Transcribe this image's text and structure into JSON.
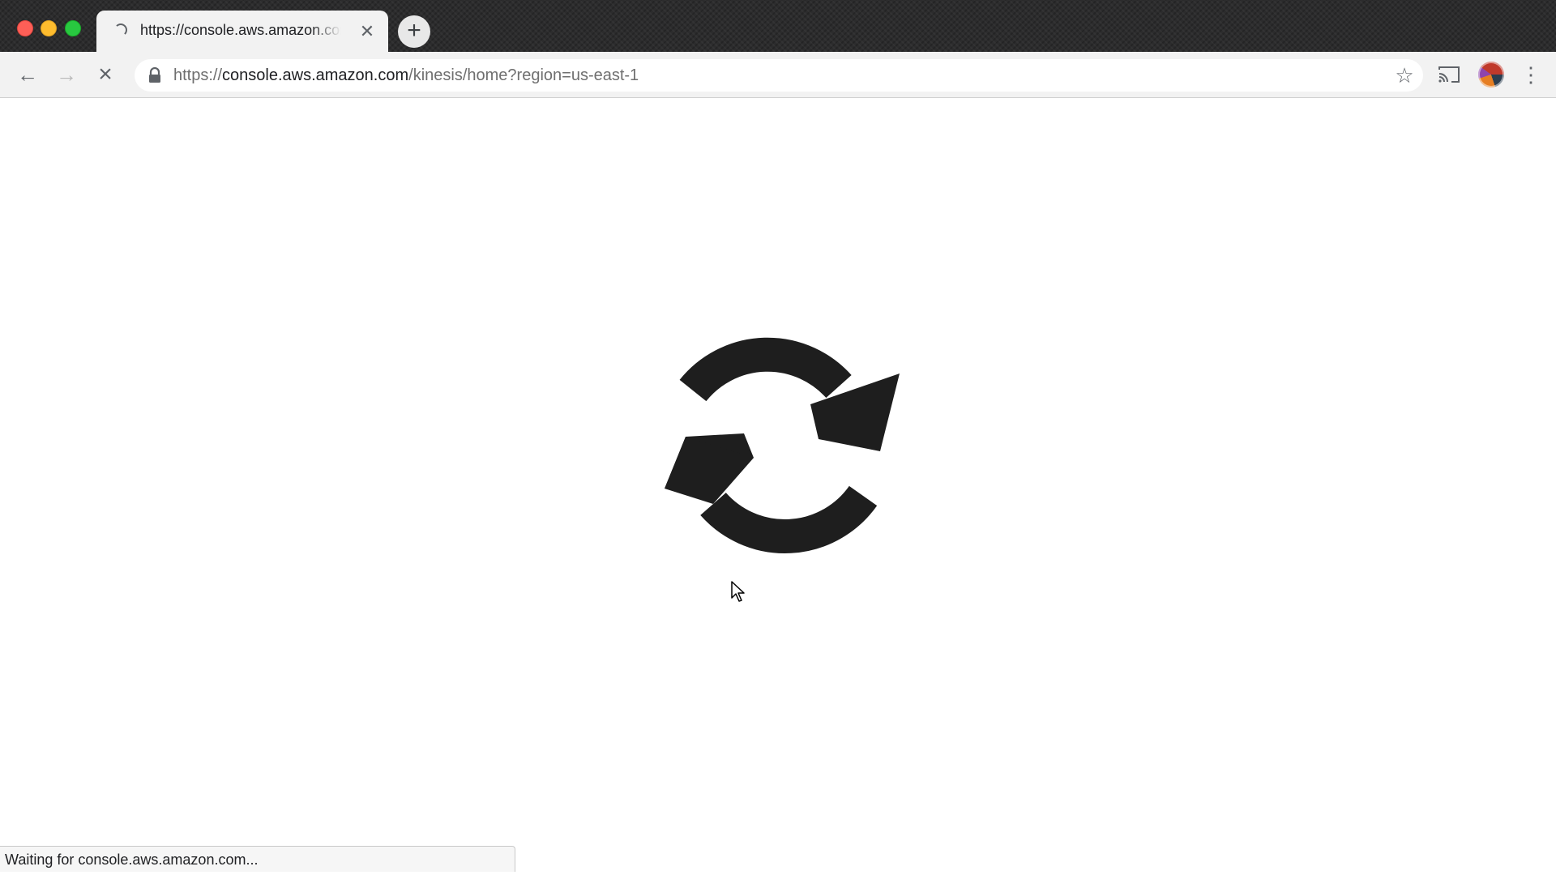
{
  "tab": {
    "title": "https://console.aws.amazon.com/kinesis/home?region=us-east-1",
    "close_icon": "close-icon",
    "loading_icon": "spinner-icon"
  },
  "new_tab": {
    "icon": "plus-icon"
  },
  "toolbar": {
    "back_icon": "arrow-left-icon",
    "forward_icon": "arrow-right-icon",
    "stop_icon": "close-icon",
    "url": {
      "scheme": "https://",
      "host": "console.aws.amazon.com",
      "path": "/kinesis/home?region=us-east-1"
    },
    "bookmark_icon": "star-outline-icon",
    "cast_icon": "cast-icon",
    "menu_icon": "kebab-menu-icon"
  },
  "content": {
    "graphic_icon": "refresh-icon"
  },
  "status": {
    "text": "Waiting for console.aws.amazon.com..."
  },
  "colors": {
    "titlebar": "#2c2c2d",
    "toolbar": "#f2f2f2",
    "traffic_red": "#fe5f57",
    "traffic_yellow": "#febc2e",
    "traffic_green": "#28c840",
    "graphic": "#1e1e1e"
  }
}
